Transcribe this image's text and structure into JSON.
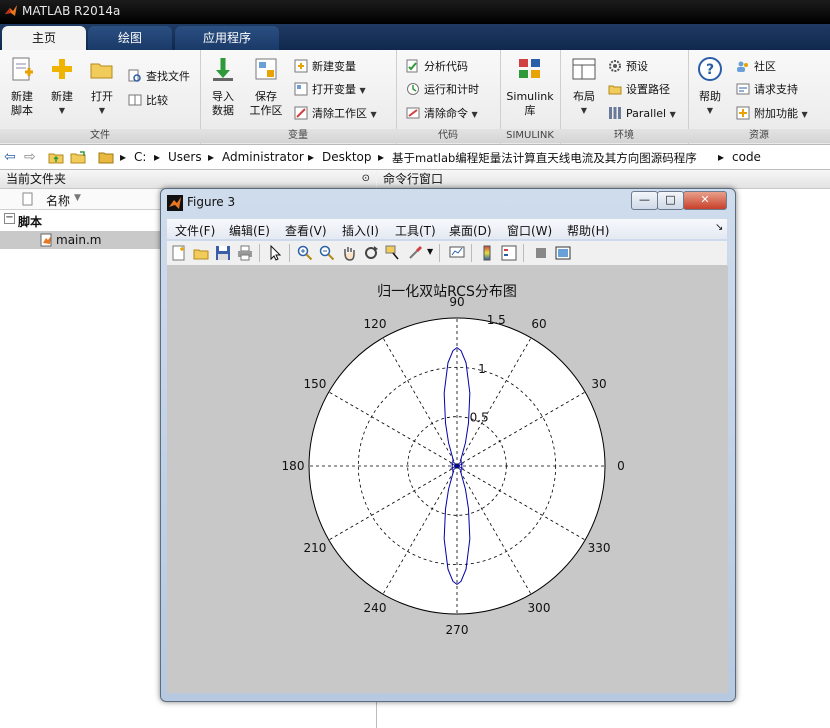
{
  "app": {
    "title": "MATLAB R2014a"
  },
  "tabs": [
    {
      "label": "主页",
      "active": true
    },
    {
      "label": "绘图",
      "active": false
    },
    {
      "label": "应用程序",
      "active": false
    }
  ],
  "ribbon": {
    "groups": {
      "file": "文件",
      "variable": "变量",
      "code": "代码",
      "simulink": "SIMULINK",
      "environment": "环境",
      "resources": "资源"
    },
    "new_script": [
      "新建",
      "脚本"
    ],
    "new": "新建",
    "open": "打开",
    "find_files": "查找文件",
    "compare": "比较",
    "import_data": [
      "导入",
      "数据"
    ],
    "save_workspace": [
      "保存",
      "工作区"
    ],
    "new_variable": "新建变量",
    "open_variable": "打开变量",
    "clear_workspace": "清除工作区",
    "analyze_code": "分析代码",
    "run_and_time": "运行和计时",
    "clear_commands": "清除命令",
    "simulink_library": [
      "Simulink",
      "库"
    ],
    "layout": "布局",
    "preferences": "预设",
    "set_path": "设置路径",
    "parallel": "Parallel",
    "help": "帮助",
    "community": "社区",
    "request_support": "请求支持",
    "addons": "附加功能"
  },
  "address": {
    "segments": [
      "C:",
      "Users",
      "Administrator",
      "Desktop",
      "基于matlab编程矩量法计算直天线电流及其方向图源码程序",
      "code"
    ]
  },
  "left_panel": {
    "title": "当前文件夹",
    "column": "名称",
    "folder": "脚本",
    "file": "main.m"
  },
  "right_panel": {
    "title": "命令行窗口"
  },
  "figure": {
    "title": "Figure 3",
    "menus": [
      "文件(F)",
      "编辑(E)",
      "查看(V)",
      "插入(I)",
      "工具(T)",
      "桌面(D)",
      "窗口(W)",
      "帮助(H)"
    ],
    "window_buttons": {
      "minimize": "—",
      "maximize": "□",
      "close": "✕"
    }
  },
  "chart_data": {
    "type": "line",
    "title": "归一化双站RCS分布图",
    "projection": "polar",
    "rlim": [
      0,
      1.5
    ],
    "r_ticks": [
      "0.5",
      "1",
      "1.5"
    ],
    "theta_ticks": [
      "0",
      "30",
      "60",
      "90",
      "120",
      "150",
      "180",
      "210",
      "240",
      "270",
      "300",
      "330"
    ],
    "grid": true,
    "series_color": "#0000a8",
    "series": [
      {
        "theta_deg": [
          0,
          30,
          60,
          70,
          75,
          80,
          85,
          88,
          90,
          92,
          95,
          100,
          105,
          110,
          120,
          150,
          180,
          210,
          240,
          250,
          255,
          260,
          265,
          268,
          270,
          272,
          275,
          280,
          285,
          290,
          300,
          330,
          360
        ],
        "r": [
          0.05,
          0.05,
          0.08,
          0.25,
          0.45,
          0.75,
          1.05,
          1.17,
          1.2,
          1.17,
          1.05,
          0.75,
          0.45,
          0.25,
          0.08,
          0.05,
          0.05,
          0.05,
          0.08,
          0.25,
          0.45,
          0.75,
          1.05,
          1.17,
          1.2,
          1.17,
          1.05,
          0.75,
          0.45,
          0.25,
          0.08,
          0.05,
          0.05
        ]
      }
    ]
  },
  "colors": {
    "accent": "#2b4f82",
    "figure_bg": "#c8c8c8",
    "line": "#0000a8"
  }
}
